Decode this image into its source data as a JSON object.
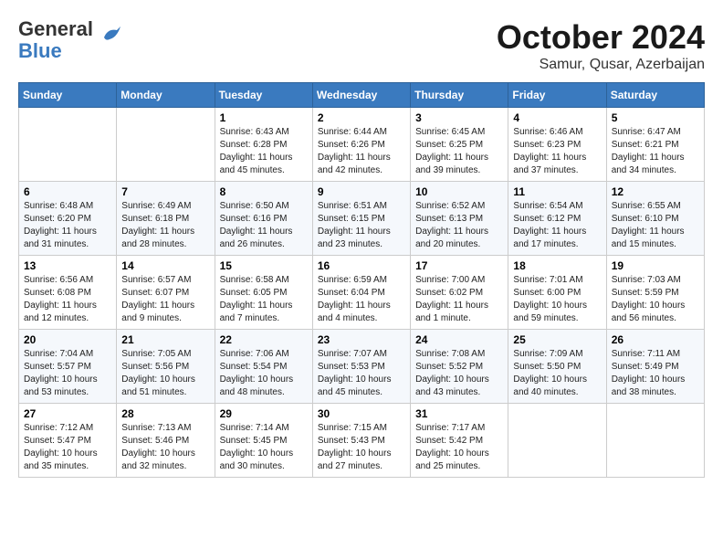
{
  "logo": {
    "general": "General",
    "blue": "Blue"
  },
  "title": "October 2024",
  "location": "Samur, Qusar, Azerbaijan",
  "days_of_week": [
    "Sunday",
    "Monday",
    "Tuesday",
    "Wednesday",
    "Thursday",
    "Friday",
    "Saturday"
  ],
  "weeks": [
    [
      {
        "day": "",
        "sunrise": "",
        "sunset": "",
        "daylight": ""
      },
      {
        "day": "",
        "sunrise": "",
        "sunset": "",
        "daylight": ""
      },
      {
        "day": "1",
        "sunrise": "Sunrise: 6:43 AM",
        "sunset": "Sunset: 6:28 PM",
        "daylight": "Daylight: 11 hours and 45 minutes."
      },
      {
        "day": "2",
        "sunrise": "Sunrise: 6:44 AM",
        "sunset": "Sunset: 6:26 PM",
        "daylight": "Daylight: 11 hours and 42 minutes."
      },
      {
        "day": "3",
        "sunrise": "Sunrise: 6:45 AM",
        "sunset": "Sunset: 6:25 PM",
        "daylight": "Daylight: 11 hours and 39 minutes."
      },
      {
        "day": "4",
        "sunrise": "Sunrise: 6:46 AM",
        "sunset": "Sunset: 6:23 PM",
        "daylight": "Daylight: 11 hours and 37 minutes."
      },
      {
        "day": "5",
        "sunrise": "Sunrise: 6:47 AM",
        "sunset": "Sunset: 6:21 PM",
        "daylight": "Daylight: 11 hours and 34 minutes."
      }
    ],
    [
      {
        "day": "6",
        "sunrise": "Sunrise: 6:48 AM",
        "sunset": "Sunset: 6:20 PM",
        "daylight": "Daylight: 11 hours and 31 minutes."
      },
      {
        "day": "7",
        "sunrise": "Sunrise: 6:49 AM",
        "sunset": "Sunset: 6:18 PM",
        "daylight": "Daylight: 11 hours and 28 minutes."
      },
      {
        "day": "8",
        "sunrise": "Sunrise: 6:50 AM",
        "sunset": "Sunset: 6:16 PM",
        "daylight": "Daylight: 11 hours and 26 minutes."
      },
      {
        "day": "9",
        "sunrise": "Sunrise: 6:51 AM",
        "sunset": "Sunset: 6:15 PM",
        "daylight": "Daylight: 11 hours and 23 minutes."
      },
      {
        "day": "10",
        "sunrise": "Sunrise: 6:52 AM",
        "sunset": "Sunset: 6:13 PM",
        "daylight": "Daylight: 11 hours and 20 minutes."
      },
      {
        "day": "11",
        "sunrise": "Sunrise: 6:54 AM",
        "sunset": "Sunset: 6:12 PM",
        "daylight": "Daylight: 11 hours and 17 minutes."
      },
      {
        "day": "12",
        "sunrise": "Sunrise: 6:55 AM",
        "sunset": "Sunset: 6:10 PM",
        "daylight": "Daylight: 11 hours and 15 minutes."
      }
    ],
    [
      {
        "day": "13",
        "sunrise": "Sunrise: 6:56 AM",
        "sunset": "Sunset: 6:08 PM",
        "daylight": "Daylight: 11 hours and 12 minutes."
      },
      {
        "day": "14",
        "sunrise": "Sunrise: 6:57 AM",
        "sunset": "Sunset: 6:07 PM",
        "daylight": "Daylight: 11 hours and 9 minutes."
      },
      {
        "day": "15",
        "sunrise": "Sunrise: 6:58 AM",
        "sunset": "Sunset: 6:05 PM",
        "daylight": "Daylight: 11 hours and 7 minutes."
      },
      {
        "day": "16",
        "sunrise": "Sunrise: 6:59 AM",
        "sunset": "Sunset: 6:04 PM",
        "daylight": "Daylight: 11 hours and 4 minutes."
      },
      {
        "day": "17",
        "sunrise": "Sunrise: 7:00 AM",
        "sunset": "Sunset: 6:02 PM",
        "daylight": "Daylight: 11 hours and 1 minute."
      },
      {
        "day": "18",
        "sunrise": "Sunrise: 7:01 AM",
        "sunset": "Sunset: 6:00 PM",
        "daylight": "Daylight: 10 hours and 59 minutes."
      },
      {
        "day": "19",
        "sunrise": "Sunrise: 7:03 AM",
        "sunset": "Sunset: 5:59 PM",
        "daylight": "Daylight: 10 hours and 56 minutes."
      }
    ],
    [
      {
        "day": "20",
        "sunrise": "Sunrise: 7:04 AM",
        "sunset": "Sunset: 5:57 PM",
        "daylight": "Daylight: 10 hours and 53 minutes."
      },
      {
        "day": "21",
        "sunrise": "Sunrise: 7:05 AM",
        "sunset": "Sunset: 5:56 PM",
        "daylight": "Daylight: 10 hours and 51 minutes."
      },
      {
        "day": "22",
        "sunrise": "Sunrise: 7:06 AM",
        "sunset": "Sunset: 5:54 PM",
        "daylight": "Daylight: 10 hours and 48 minutes."
      },
      {
        "day": "23",
        "sunrise": "Sunrise: 7:07 AM",
        "sunset": "Sunset: 5:53 PM",
        "daylight": "Daylight: 10 hours and 45 minutes."
      },
      {
        "day": "24",
        "sunrise": "Sunrise: 7:08 AM",
        "sunset": "Sunset: 5:52 PM",
        "daylight": "Daylight: 10 hours and 43 minutes."
      },
      {
        "day": "25",
        "sunrise": "Sunrise: 7:09 AM",
        "sunset": "Sunset: 5:50 PM",
        "daylight": "Daylight: 10 hours and 40 minutes."
      },
      {
        "day": "26",
        "sunrise": "Sunrise: 7:11 AM",
        "sunset": "Sunset: 5:49 PM",
        "daylight": "Daylight: 10 hours and 38 minutes."
      }
    ],
    [
      {
        "day": "27",
        "sunrise": "Sunrise: 7:12 AM",
        "sunset": "Sunset: 5:47 PM",
        "daylight": "Daylight: 10 hours and 35 minutes."
      },
      {
        "day": "28",
        "sunrise": "Sunrise: 7:13 AM",
        "sunset": "Sunset: 5:46 PM",
        "daylight": "Daylight: 10 hours and 32 minutes."
      },
      {
        "day": "29",
        "sunrise": "Sunrise: 7:14 AM",
        "sunset": "Sunset: 5:45 PM",
        "daylight": "Daylight: 10 hours and 30 minutes."
      },
      {
        "day": "30",
        "sunrise": "Sunrise: 7:15 AM",
        "sunset": "Sunset: 5:43 PM",
        "daylight": "Daylight: 10 hours and 27 minutes."
      },
      {
        "day": "31",
        "sunrise": "Sunrise: 7:17 AM",
        "sunset": "Sunset: 5:42 PM",
        "daylight": "Daylight: 10 hours and 25 minutes."
      },
      {
        "day": "",
        "sunrise": "",
        "sunset": "",
        "daylight": ""
      },
      {
        "day": "",
        "sunrise": "",
        "sunset": "",
        "daylight": ""
      }
    ]
  ]
}
